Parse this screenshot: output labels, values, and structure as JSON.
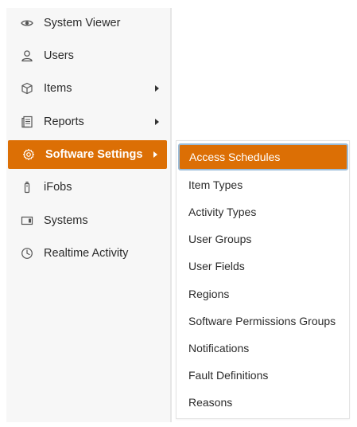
{
  "sidebar": {
    "items": [
      {
        "label": "System Viewer",
        "icon": "eye-icon"
      },
      {
        "label": "Users",
        "icon": "user-icon"
      },
      {
        "label": "Items",
        "icon": "cube-icon",
        "has_submenu": true
      },
      {
        "label": "Reports",
        "icon": "report-icon",
        "has_submenu": true
      },
      {
        "label": "Software Settings",
        "icon": "gear-icon",
        "has_submenu": true,
        "active": true
      },
      {
        "label": "iFobs",
        "icon": "fob-icon"
      },
      {
        "label": "Systems",
        "icon": "systems-icon"
      },
      {
        "label": "Realtime Activity",
        "icon": "clock-icon"
      }
    ]
  },
  "submenu": {
    "items": [
      {
        "label": "Access Schedules",
        "active": true
      },
      {
        "label": "Item Types"
      },
      {
        "label": "Activity Types"
      },
      {
        "label": "User Groups"
      },
      {
        "label": "User Fields"
      },
      {
        "label": "Regions"
      },
      {
        "label": "Software Permissions Groups"
      },
      {
        "label": "Notifications"
      },
      {
        "label": "Fault Definitions"
      },
      {
        "label": "Reasons"
      }
    ]
  },
  "colors": {
    "accent": "#dc6f05",
    "focus_ring": "#9bbcd9",
    "sidebar_bg": "#f7f7f7"
  }
}
